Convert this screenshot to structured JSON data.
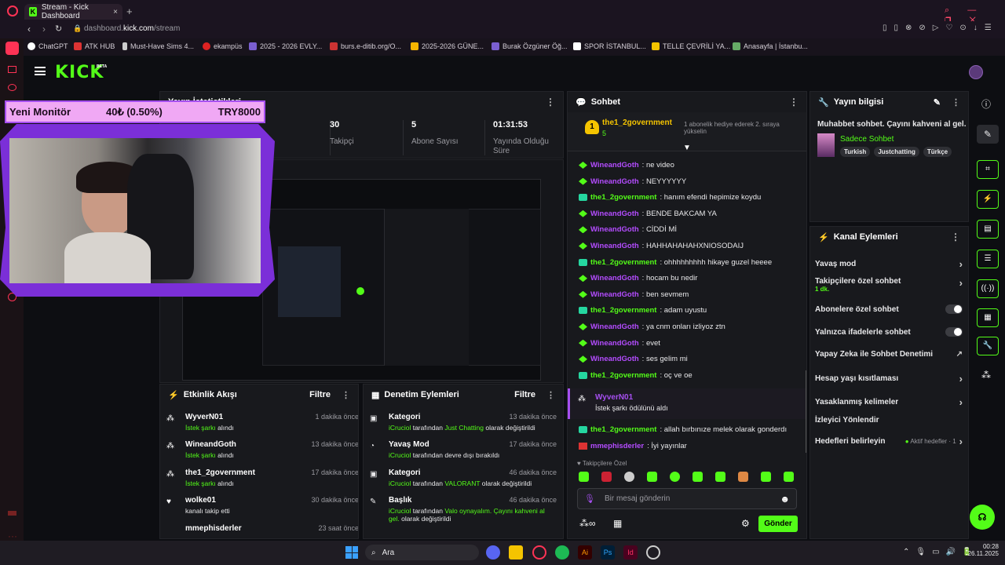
{
  "browser": {
    "tab_title": "Stream - Kick Dashboard",
    "url_prefix": "dashboard.",
    "url_domain": "kick.com",
    "url_path": "/stream",
    "bookmarks": [
      "ChatGPT",
      "ATK HUB",
      "Must-Have Sims 4...",
      "ekampüs",
      "2025 - 2026 EVLY...",
      "burs.e-ditib.org/O...",
      "2025-2026 GÜNE...",
      "Burak Özgüner Öğ...",
      "SPOR İSTANBUL...",
      "TELLE ÇEVRİLİ YA...",
      "Anasayfa | İstanbu..."
    ]
  },
  "kick": {
    "logo": "KICK",
    "beta": "BETA"
  },
  "overlay": {
    "goal_title": "Yeni Monitör",
    "goal_progress": "40₺ (0.50%)",
    "goal_target": "TRY8000"
  },
  "stats": {
    "title": "Yayın İstatistikleri",
    "items": [
      {
        "value": "30",
        "label": "Takipçi"
      },
      {
        "value": "5",
        "label": "Abone Sayısı"
      },
      {
        "value": "01:31:53",
        "label": "Yayında Olduğu Süre"
      }
    ]
  },
  "activity": {
    "title": "Etkinlik Akışı",
    "filter": "Filtre",
    "items": [
      {
        "name": "WyverN01",
        "action": "İstek şarkı",
        "suffix": "alındı",
        "time": "1 dakika önce"
      },
      {
        "name": "WineandGoth",
        "action": "İstek şarkı",
        "suffix": "alındı",
        "time": "13 dakika önce"
      },
      {
        "name": "the1_2government",
        "action": "İstek şarkı",
        "suffix": "alındı",
        "time": "17 dakika önce"
      },
      {
        "name": "wolke01",
        "action": "kanalı takip etti",
        "suffix": "",
        "time": "30 dakika önce"
      },
      {
        "name": "mmephisderler",
        "action": "",
        "suffix": "",
        "time": "23 saat önce"
      }
    ]
  },
  "moderation": {
    "title": "Denetim Eylemleri",
    "filter": "Filtre",
    "items": [
      {
        "title": "Kategori",
        "user": "iCruciol",
        "mid": "tarafından",
        "value": "Just Chatting",
        "end": "olarak değiştirildi",
        "time": "13 dakika önce"
      },
      {
        "title": "Yavaş Mod",
        "user": "iCruciol",
        "mid": "tarafından devre dışı bırakıldı",
        "value": "",
        "end": "",
        "time": "17 dakika önce"
      },
      {
        "title": "Kategori",
        "user": "iCruciol",
        "mid": "tarafından",
        "value": "VALORANT",
        "end": "olarak değiştirildi",
        "time": "46 dakika önce"
      },
      {
        "title": "Başlık",
        "user": "iCruciol",
        "mid": "tarafından",
        "value": "Valo oynayalım. Çayını kahveni al gel.",
        "end": "olarak değiştirildi",
        "time": "46 dakika önce"
      }
    ]
  },
  "chat": {
    "title": "Sohbet",
    "pinned_user": "the1_2government",
    "pinned_count": "5",
    "pinned_msg": "1 abonelik hediye ederek 2. sıraya yükselin",
    "messages": [
      {
        "user": "WineandGoth",
        "text": ": ne video",
        "badge": "diam"
      },
      {
        "user": "WineandGoth",
        "text": ": NEYYYYYY",
        "badge": "diam"
      },
      {
        "user": "the1_2government",
        "text": ": hanım efendi hepimize koydu",
        "badge": "gift"
      },
      {
        "user": "WineandGoth",
        "text": ": BENDE BAKCAM YA",
        "badge": "diam"
      },
      {
        "user": "WineandGoth",
        "text": ": CİDDİ Mİ",
        "badge": "diam"
      },
      {
        "user": "WineandGoth",
        "text": ": HAHHAHAHAHXNIOSODAIJ",
        "badge": "diam"
      },
      {
        "user": "the1_2government",
        "text": ": ohhhhhhhhh hikaye guzel heeee",
        "badge": "gift"
      },
      {
        "user": "WineandGoth",
        "text": ": hocam bu nedir",
        "badge": "diam"
      },
      {
        "user": "WineandGoth",
        "text": ": ben sevmem",
        "badge": "diam"
      },
      {
        "user": "the1_2government",
        "text": ": adam uyustu",
        "badge": "gift"
      },
      {
        "user": "WineandGoth",
        "text": ": ya cnm onları izliyoz ztn",
        "badge": "diam"
      },
      {
        "user": "WineandGoth",
        "text": ": evet",
        "badge": "diam"
      },
      {
        "user": "WineandGoth",
        "text": ": ses gelim mi",
        "badge": "diam"
      },
      {
        "user": "the1_2government",
        "text": ": oç ve oe",
        "badge": "gift"
      }
    ],
    "event_user": "WyverN01",
    "event_reward": "İstek şarkı",
    "event_text": "ödülünü aldı",
    "after": [
      {
        "user": "the1_2government",
        "text": ": allah bırbınıze melek olarak gonderdı"
      },
      {
        "user": "mmephisderler",
        "text": ": İyi yayınlar"
      }
    ],
    "emote_label": "Takipçilere Özel",
    "input_placeholder": "Bir mesaj gönderin",
    "send": "Gönder"
  },
  "info": {
    "title": "Yayın bilgisi",
    "stream_title": "Muhabbet sohbet. Çayını kahveni al gel.",
    "category": "Sadece Sohbet",
    "tags": [
      "Turkish",
      "Justchatting",
      "Türkçe"
    ]
  },
  "actions": {
    "title": "Kanal Eylemleri",
    "items": [
      {
        "label": "Yavaş mod",
        "sub": "",
        "control": "chev"
      },
      {
        "label": "Takipçilere özel sohbet",
        "sub": "1 dk.",
        "control": "chev"
      },
      {
        "label": "Abonelere özel sohbet",
        "sub": "",
        "control": "toggle"
      },
      {
        "label": "Yalnızca ifadelerle sohbet",
        "sub": "",
        "control": "toggle"
      },
      {
        "label": "Yapay Zeka ile Sohbet Denetimi",
        "sub": "",
        "control": "ext"
      },
      {
        "label": "Hesap yaşı kısıtlaması",
        "sub": "",
        "control": "chev"
      },
      {
        "label": "Yasaklanmış kelimeler",
        "sub": "",
        "control": "chev"
      },
      {
        "label": "İzleyici Yönlendir",
        "sub": "",
        "control": ""
      },
      {
        "label": "Hedefleri belirleyin",
        "sub": "",
        "control": "chev",
        "extra": "Aktif hedefler · 1"
      }
    ]
  },
  "taskbar": {
    "search": "Ara",
    "time": "00:28",
    "date": "26.11.2025"
  }
}
